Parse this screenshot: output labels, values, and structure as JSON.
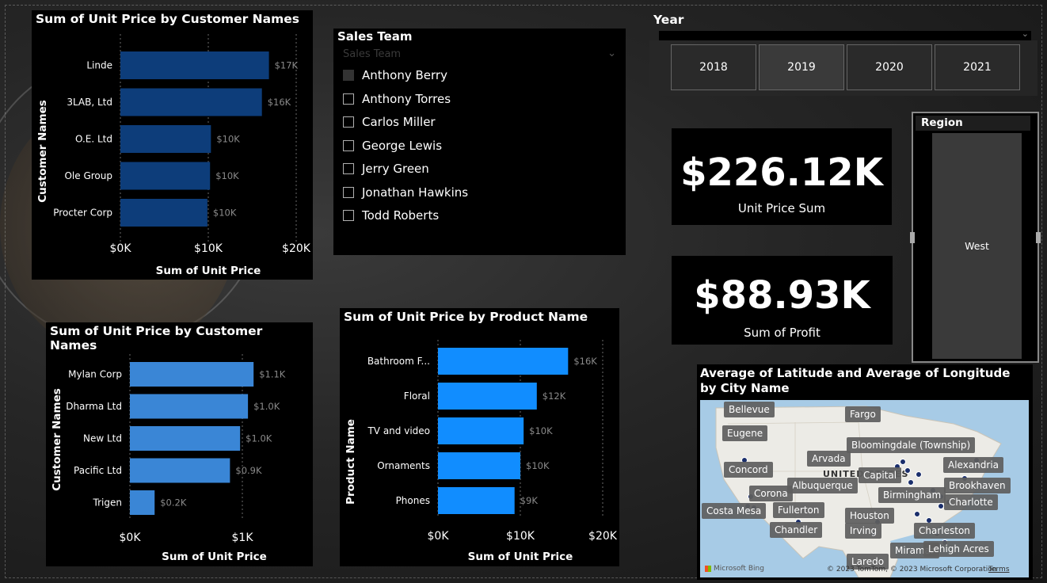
{
  "colors": {
    "dark_blue": "#0d3d7a",
    "mid_blue": "#3a86d6",
    "bright_blue": "#118dff",
    "panel": "#000000"
  },
  "chart_data": [
    {
      "type": "bar",
      "orientation": "horizontal",
      "title": "Sum of Unit Price by Customer Names",
      "xlabel": "Sum of Unit Price",
      "ylabel": "Customer Names",
      "categories": [
        "Linde",
        "3LAB, Ltd",
        "O.E. Ltd",
        "Ole Group",
        "Procter Corp"
      ],
      "values": [
        16900,
        16100,
        10300,
        10200,
        9900
      ],
      "data_labels": [
        "$17K",
        "$16K",
        "$10K",
        "$10K",
        "$10K"
      ],
      "xlim": [
        0,
        20000
      ],
      "ticks": [
        "$0K",
        "$10K",
        "$20K"
      ],
      "color": "#0d3d7a"
    },
    {
      "type": "bar",
      "orientation": "horizontal",
      "title": "Sum of Unit Price by Customer Names",
      "xlabel": "Sum of Unit Price",
      "ylabel": "Customer Names",
      "categories": [
        "Mylan Corp",
        "Dharma Ltd",
        "New Ltd",
        "Pacific Ltd",
        "Trigen"
      ],
      "values": [
        1100,
        1050,
        980,
        890,
        220
      ],
      "data_labels": [
        "$1.1K",
        "$1.0K",
        "$1.0K",
        "$0.9K",
        "$0.2K"
      ],
      "xlim": [
        0,
        1500
      ],
      "ticks": [
        "$0K",
        "$1K"
      ],
      "color": "#3a86d6"
    },
    {
      "type": "bar",
      "orientation": "horizontal",
      "title": "Sum of Unit Price by Product Name",
      "xlabel": "Sum of Unit Price",
      "ylabel": "Product Name",
      "categories": [
        "Bathroom F...",
        "Floral",
        "TV and video",
        "Ornaments",
        "Phones"
      ],
      "values": [
        15800,
        12000,
        10400,
        10000,
        9300
      ],
      "data_labels": [
        "$16K",
        "$12K",
        "$10K",
        "$10K",
        "$9K"
      ],
      "xlim": [
        0,
        20000
      ],
      "ticks": [
        "$0K",
        "$10K",
        "$20K"
      ],
      "color": "#118dff"
    }
  ],
  "sales_team": {
    "title": "Sales Team",
    "placeholder": "Sales Team",
    "items": [
      "Anthony Berry",
      "Anthony Torres",
      "Carlos Miller",
      "George Lewis",
      "Jerry Green",
      "Jonathan Hawkins",
      "Todd Roberts"
    ]
  },
  "year": {
    "title": "Year",
    "options": [
      "2018",
      "2019",
      "2020",
      "2021"
    ]
  },
  "kpi1": {
    "value": "$226.12K",
    "label": "Unit Price Sum"
  },
  "kpi2": {
    "value": "$88.93K",
    "label": "Sum of Profit"
  },
  "region": {
    "title": "Region",
    "value": "West"
  },
  "map": {
    "title": "Average of Latitude and Average of Longitude by City Name",
    "country": "UNITED STATES",
    "cities": [
      "Bellevue",
      "Fargo",
      "Eugene",
      "Bloomingdale (Township)",
      "Arvada",
      "Concord",
      "Capital",
      "Alexandria",
      "Albuquerque",
      "Brookhaven",
      "Corona",
      "Birmingham",
      "Charlotte",
      "Costa Mesa",
      "Fullerton",
      "Houston",
      "Chandler",
      "Irving",
      "Charleston",
      "Miramar",
      "Lehigh Acres",
      "Laredo"
    ],
    "attribution": "© 2023 TomTom, © 2023 Microsoft Corporation",
    "terms": "Terms",
    "bing": "Microsoft Bing"
  }
}
